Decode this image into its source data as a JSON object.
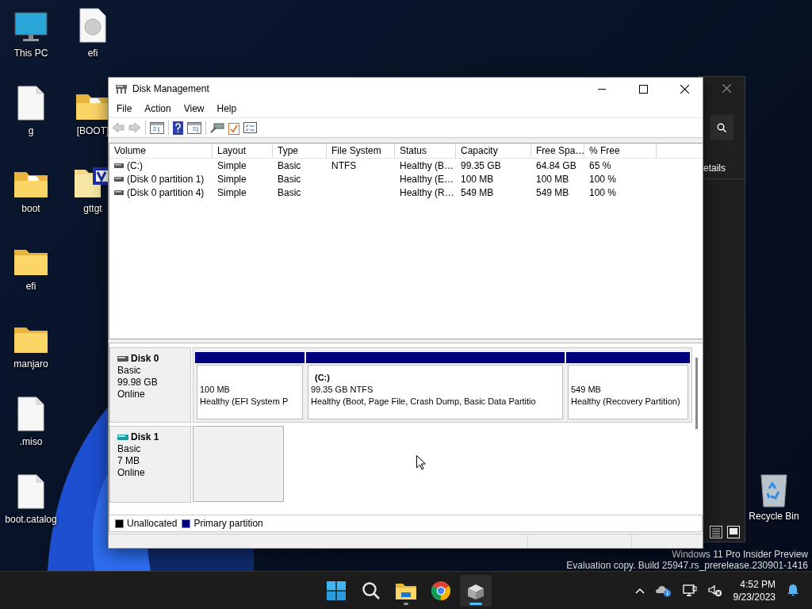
{
  "desktop_icons": [
    {
      "label": "This PC",
      "kind": "pc"
    },
    {
      "label": "g",
      "kind": "file"
    },
    {
      "label": "boot",
      "kind": "folder-doc"
    },
    {
      "label": "efi",
      "kind": "folder"
    },
    {
      "label": "manjaro",
      "kind": "folder"
    },
    {
      "label": ".miso",
      "kind": "file"
    },
    {
      "label": "boot.catalog",
      "kind": "file"
    },
    {
      "label": "efi",
      "kind": "disc"
    },
    {
      "label": "[BOOT]",
      "kind": "folder-doc"
    },
    {
      "label": "gttgt",
      "kind": "app"
    }
  ],
  "recycle_bin": {
    "label": "Recycle Bin"
  },
  "background_window": {
    "label": "etails"
  },
  "window": {
    "title": "Disk Management",
    "menu": [
      "File",
      "Action",
      "View",
      "Help"
    ],
    "toolbar": [
      {
        "kind": "back",
        "disabled": true
      },
      {
        "kind": "forward",
        "disabled": true
      },
      {
        "kind": "tree",
        "disabled": false
      },
      {
        "kind": "help",
        "disabled": false
      },
      {
        "kind": "pane",
        "disabled": false
      },
      {
        "kind": "connect",
        "disabled": false
      },
      {
        "kind": "check",
        "disabled": false
      },
      {
        "kind": "properties",
        "disabled": false
      }
    ],
    "table": {
      "columns": [
        "Volume",
        "Layout",
        "Type",
        "File System",
        "Status",
        "Capacity",
        "Free Spa…",
        "% Free"
      ],
      "rows": [
        [
          "(C:)",
          "Simple",
          "Basic",
          "NTFS",
          "Healthy (B…",
          "99.35 GB",
          "64.84 GB",
          "65 %"
        ],
        [
          "(Disk 0 partition 1)",
          "Simple",
          "Basic",
          "",
          "Healthy (E…",
          "100 MB",
          "100 MB",
          "100 %"
        ],
        [
          "(Disk 0 partition 4)",
          "Simple",
          "Basic",
          "",
          "Healthy (R…",
          "549 MB",
          "549 MB",
          "100 %"
        ]
      ]
    },
    "disks": [
      {
        "name": "Disk 0",
        "kind": "fixed",
        "type": "Basic",
        "size": "99.98 GB",
        "status": "Online",
        "partitions": [
          {
            "kind": "primary",
            "color": "#00007f",
            "size": "100 MB",
            "status": "Healthy (EFI System P"
          },
          {
            "kind": "primary",
            "color": "#00007f",
            "name": "(C:)",
            "size": "99.35 GB NTFS",
            "status": "Healthy (Boot, Page File, Crash Dump, Basic Data Partitio"
          },
          {
            "kind": "primary",
            "color": "#00007f",
            "size": "549 MB",
            "status": "Healthy (Recovery Partition)"
          }
        ]
      },
      {
        "name": "Disk 1",
        "kind": "removable",
        "type": "Basic",
        "size": "7 MB",
        "status": "Online",
        "partitions": [
          {
            "kind": "empty"
          }
        ]
      }
    ],
    "legend": [
      {
        "label": "Unallocated",
        "color": "#000000"
      },
      {
        "label": "Primary partition",
        "color": "#00007f"
      }
    ]
  },
  "watermark": [
    "Windows 11 Pro Insider Preview",
    "Evaluation copy. Build 25947.rs_prerelease.230901-1416"
  ],
  "taskbar": {
    "apps": [
      {
        "kind": "start",
        "running": false,
        "selected": false
      },
      {
        "kind": "search",
        "running": false,
        "selected": false
      },
      {
        "kind": "explorer",
        "running": true,
        "selected": false
      },
      {
        "kind": "chrome",
        "running": false,
        "selected": false
      },
      {
        "kind": "diskmgmt",
        "running": true,
        "selected": true
      }
    ],
    "tray": [
      {
        "kind": "chevron"
      },
      {
        "kind": "onedrive"
      },
      {
        "kind": "network"
      },
      {
        "kind": "volume-muted"
      }
    ],
    "time": "4:52 PM",
    "date": "9/23/2023",
    "notifications": {
      "kind": "bell"
    }
  }
}
